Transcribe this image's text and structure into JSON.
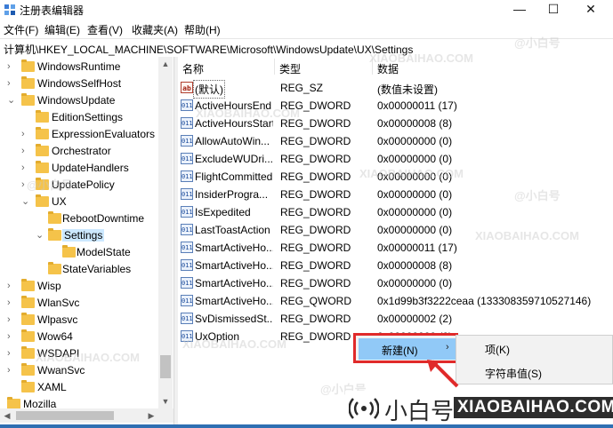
{
  "window": {
    "title": "注册表编辑器",
    "min_glyph": "—",
    "max_glyph": "☐",
    "close_glyph": "✕"
  },
  "menu": [
    "文件(F)",
    "编辑(E)",
    "查看(V)",
    "收藏夹(A)",
    "帮助(H)"
  ],
  "address": "计算机\\HKEY_LOCAL_MACHINE\\SOFTWARE\\Microsoft\\WindowsUpdate\\UX\\Settings",
  "tree": [
    {
      "label": "WindowsRuntime",
      "chev": "›"
    },
    {
      "label": "WindowsSelfHost",
      "chev": "›"
    },
    {
      "label": "WindowsUpdate",
      "chev": "⌄"
    },
    {
      "label": "EditionSettings",
      "chev": ""
    },
    {
      "label": "ExpressionEvaluators",
      "chev": "›"
    },
    {
      "label": "Orchestrator",
      "chev": "›"
    },
    {
      "label": "UpdateHandlers",
      "chev": "›"
    },
    {
      "label": "UpdatePolicy",
      "chev": "›"
    },
    {
      "label": "UX",
      "chev": "⌄"
    },
    {
      "label": "RebootDowntime",
      "chev": ""
    },
    {
      "label": "Settings",
      "chev": "⌄"
    },
    {
      "label": "ModelState",
      "chev": ""
    },
    {
      "label": "StateVariables",
      "chev": ""
    },
    {
      "label": "Wisp",
      "chev": "›"
    },
    {
      "label": "WlanSvc",
      "chev": "›"
    },
    {
      "label": "Wlpasvc",
      "chev": "›"
    },
    {
      "label": "Wow64",
      "chev": "›"
    },
    {
      "label": "WSDAPI",
      "chev": "›"
    },
    {
      "label": "WwanSvc",
      "chev": "›"
    },
    {
      "label": "XAML",
      "chev": "›"
    },
    {
      "label": "Mozilla",
      "chev": "›"
    }
  ],
  "columns": {
    "name": "名称",
    "type": "类型",
    "data": "数据"
  },
  "values": [
    {
      "name": "(默认)",
      "type": "REG_SZ",
      "data": "(数值未设置)",
      "icon": "ab"
    },
    {
      "name": "ActiveHoursEnd",
      "type": "REG_DWORD",
      "data": "0x00000011 (17)",
      "icon": "011"
    },
    {
      "name": "ActiveHoursStart",
      "type": "REG_DWORD",
      "data": "0x00000008 (8)",
      "icon": "011"
    },
    {
      "name": "AllowAutoWin...",
      "type": "REG_DWORD",
      "data": "0x00000000 (0)",
      "icon": "011"
    },
    {
      "name": "ExcludeWUDri...",
      "type": "REG_DWORD",
      "data": "0x00000000 (0)",
      "icon": "011"
    },
    {
      "name": "FlightCommitted",
      "type": "REG_DWORD",
      "data": "0x00000000 (0)",
      "icon": "011"
    },
    {
      "name": "InsiderProgra...",
      "type": "REG_DWORD",
      "data": "0x00000000 (0)",
      "icon": "011"
    },
    {
      "name": "IsExpedited",
      "type": "REG_DWORD",
      "data": "0x00000000 (0)",
      "icon": "011"
    },
    {
      "name": "LastToastAction",
      "type": "REG_DWORD",
      "data": "0x00000000 (0)",
      "icon": "011"
    },
    {
      "name": "SmartActiveHo...",
      "type": "REG_DWORD",
      "data": "0x00000011 (17)",
      "icon": "011"
    },
    {
      "name": "SmartActiveHo...",
      "type": "REG_DWORD",
      "data": "0x00000008 (8)",
      "icon": "011"
    },
    {
      "name": "SmartActiveHo...",
      "type": "REG_DWORD",
      "data": "0x00000000 (0)",
      "icon": "011"
    },
    {
      "name": "SmartActiveHo...",
      "type": "REG_QWORD",
      "data": "0x1d99b3f3222ceaa (133308359710527146)",
      "icon": "011"
    },
    {
      "name": "SvDismissedSt...",
      "type": "REG_DWORD",
      "data": "0x00000002 (2)",
      "icon": "011"
    },
    {
      "name": "UxOption",
      "type": "REG_DWORD",
      "data": "0x00000000 (0)",
      "icon": "011"
    }
  ],
  "context_menu": {
    "new_label": "新建(N)",
    "arrow": "›"
  },
  "submenu": {
    "key_label": "项(K)",
    "string_label": "字符串值(S)"
  },
  "watermark": {
    "cn": "@小白号",
    "en": "XIAOBAIHAO.COM"
  },
  "logo": {
    "cn": "小白号",
    "en": "XIAOBAIHAO.COM"
  },
  "colors": {
    "selection": "#cce8ff",
    "menu_highlight": "#91c9f7",
    "annotation_red": "#e02a2a",
    "folder": "#f5c34a"
  }
}
